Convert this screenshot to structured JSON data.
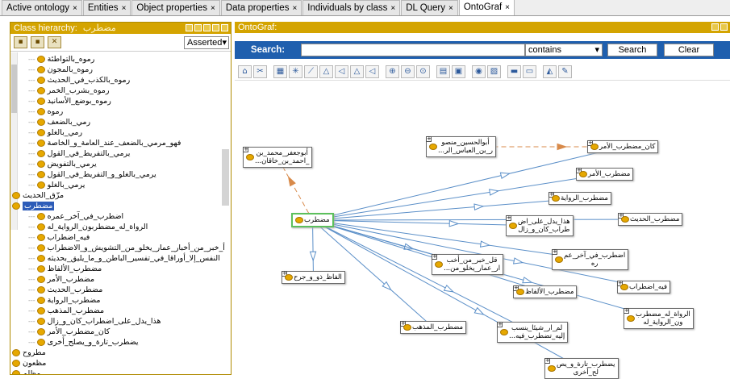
{
  "tabs": [
    {
      "label": "Active ontology",
      "active": false
    },
    {
      "label": "Entities",
      "active": false
    },
    {
      "label": "Object properties",
      "active": false
    },
    {
      "label": "Data properties",
      "active": false
    },
    {
      "label": "Individuals by class",
      "active": false
    },
    {
      "label": "DL Query",
      "active": false
    },
    {
      "label": "OntoGraf",
      "active": true
    }
  ],
  "left": {
    "title": "Class hierarchy:",
    "subtitle": "مضطرب",
    "asserted": "Asserted",
    "tree": [
      {
        "label": "رموه_بالتواطئة",
        "depth": 2
      },
      {
        "label": "رموه_بالمجون",
        "depth": 2
      },
      {
        "label": "رموه_بالكذب_في_الحديث",
        "depth": 2
      },
      {
        "label": "رموه_بشرب_الخمر",
        "depth": 2
      },
      {
        "label": "رموه_بوضع_الأسانيد",
        "depth": 2
      },
      {
        "label": "رموه",
        "depth": 2
      },
      {
        "label": "رمي_بالضعف",
        "depth": 2
      },
      {
        "label": "رمي_بالغلو",
        "depth": 2
      },
      {
        "label": "فهو_مرمي_بالضعف_عند_العامة_و_الخاصة",
        "depth": 2
      },
      {
        "label": "يرمي_بالتفريط_في_القول",
        "depth": 2
      },
      {
        "label": "يرمي_بالتفويض",
        "depth": 2
      },
      {
        "label": "يرمي_بالغلو_و_التفريط_في_القول",
        "depth": 2
      },
      {
        "label": "يرمي_بالغلو",
        "depth": 2
      },
      {
        "label": "مزّق_الحديث",
        "depth": 1
      },
      {
        "label": "مضطرب",
        "depth": 1,
        "selected": true
      },
      {
        "label": "اضطرب_في_آخر_عمره",
        "depth": 2
      },
      {
        "label": "الرواة_له_مضطربون_الرواية_له",
        "depth": 2
      },
      {
        "label": "فيه_اضطراب",
        "depth": 2
      },
      {
        "label": "أ_خبر_من_أخبار_عمار_يخلو_من_التشويش_و_الاضطراب",
        "depth": 2
      },
      {
        "label": "النفس_إلا_أوراقا_في_تفسير_الباطن_و_ما_يليق_بحديثه",
        "depth": 2
      },
      {
        "label": "مضطرب_الألفاظ",
        "depth": 2
      },
      {
        "label": "مضطرب_الأمر",
        "depth": 2
      },
      {
        "label": "مضطرب_الحديث",
        "depth": 2
      },
      {
        "label": "مضطرب_الرواية",
        "depth": 2
      },
      {
        "label": "مضطرب_المذهب",
        "depth": 2
      },
      {
        "label": "هذا_يدل_على_اضطراب_كان_و_زال",
        "depth": 2
      },
      {
        "label": "كان_مضطرب_الأمر",
        "depth": 2
      },
      {
        "label": "يضطرب_تارة_و_يصلح_أخرى",
        "depth": 2
      },
      {
        "label": "مطروح",
        "depth": 1
      },
      {
        "label": "مظعون",
        "depth": 1
      },
      {
        "label": "مظلم",
        "depth": 1
      }
    ]
  },
  "right": {
    "title": "OntoGraf:",
    "search_label": "Search:",
    "search_value": "",
    "match_mode": "contains",
    "search_button": "Search",
    "clear_button": "Clear",
    "nodes": [
      {
        "id": "center",
        "lines": [
          "مضطرب"
        ]
      },
      {
        "id": "abujafar",
        "lines": [
          "أبوجعفر_محمد_بن",
          "_احمد_بن_خاقان..."
        ]
      },
      {
        "id": "abulhusayn",
        "lines": [
          "أبوالحسين_منصو",
          "ر_بن_العباس_الر..."
        ]
      },
      {
        "id": "kan",
        "lines": [
          "كان_مضطرب_الأمر"
        ]
      },
      {
        "id": "amr",
        "lines": [
          "مضطرب_الأمر"
        ]
      },
      {
        "id": "riwaya",
        "lines": [
          "مضطرب_الرواية"
        ]
      },
      {
        "id": "hadith",
        "lines": [
          "مضطرب_الحديث"
        ]
      },
      {
        "id": "hadha",
        "lines": [
          "هذا_يدل_على_اض",
          "طراب_كان_و_زال"
        ]
      },
      {
        "id": "qal",
        "lines": [
          "قل_خبر_من_أخب",
          "ار_عمار_يخلو_من..."
        ]
      },
      {
        "id": "idtaraba",
        "lines": [
          "اضطرب_في_آخر_عم",
          "ره"
        ]
      },
      {
        "id": "alfaz_dhu",
        "lines": [
          "الفاظ_ذو_و_جرح"
        ]
      },
      {
        "id": "alfaz",
        "lines": [
          "مضطرب_الألفاظ"
        ]
      },
      {
        "id": "fihi",
        "lines": [
          "فيه_اضطراب"
        ]
      },
      {
        "id": "ruwat",
        "lines": [
          "الرواة_له_مضطرب",
          "ون_الرواية_له"
        ]
      },
      {
        "id": "madhhab",
        "lines": [
          "مضطرب_المذهب"
        ]
      },
      {
        "id": "lam",
        "lines": [
          "لم_ار_شيئا_ينسب",
          "إليه_تضطرب_فيه..."
        ]
      },
      {
        "id": "yadtarib",
        "lines": [
          "يضطرب_تارة_و_يص",
          "لح_أخرى"
        ]
      }
    ]
  }
}
